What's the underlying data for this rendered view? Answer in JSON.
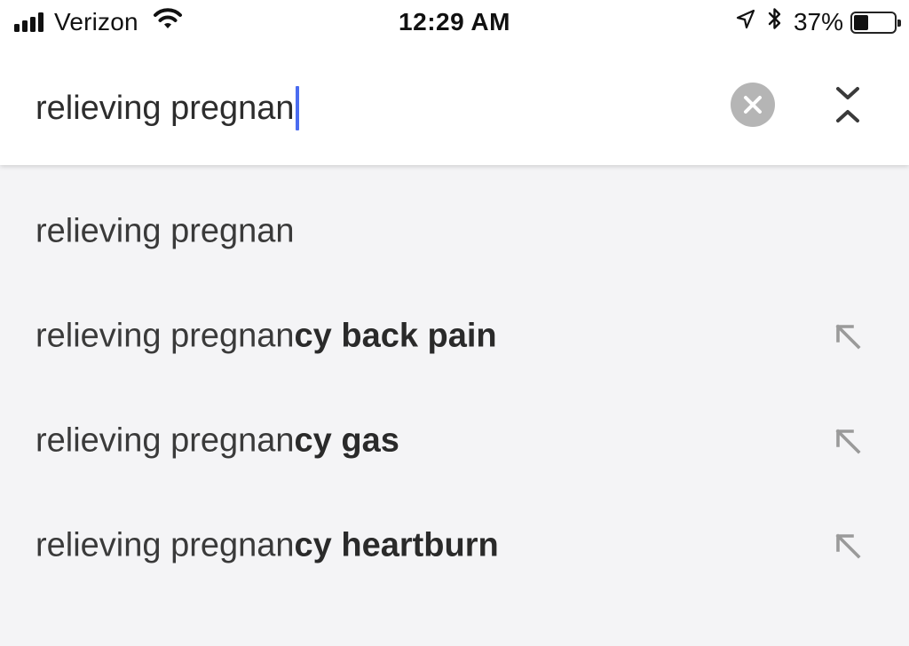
{
  "status_bar": {
    "carrier": "Verizon",
    "time": "12:29 AM",
    "battery_percent": "37%",
    "battery_level": 0.37,
    "icons": [
      "signal-icon",
      "wifi-icon",
      "location-icon",
      "bluetooth-icon",
      "battery-icon"
    ]
  },
  "search": {
    "query": "relieving pregnan",
    "caret_color": "#4a6cf0",
    "clear_icon": "close-icon",
    "collapse_icon": "collapse-chevrons-icon"
  },
  "suggestions": [
    {
      "prefix": "relieving pregnan",
      "completion": "",
      "has_fill_arrow": false
    },
    {
      "prefix": "relieving pregnan",
      "completion": "cy back pain",
      "has_fill_arrow": true
    },
    {
      "prefix": "relieving pregnan",
      "completion": "cy gas",
      "has_fill_arrow": true
    },
    {
      "prefix": "relieving pregnan",
      "completion": "cy heartburn",
      "has_fill_arrow": true
    }
  ],
  "colors": {
    "background": "#f4f4f6",
    "header": "#ffffff",
    "clear_button": "#b5b5b5",
    "arrow": "#9a9a9a"
  }
}
